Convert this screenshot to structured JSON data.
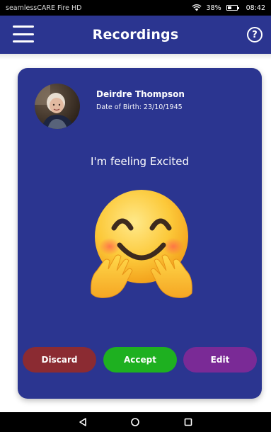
{
  "status_bar": {
    "app_name": "seamlessCARE Fire HD",
    "battery_percent": "38%",
    "battery_level": 0.38,
    "time": "08:42"
  },
  "header": {
    "title": "Recordings",
    "help_label": "?"
  },
  "patient": {
    "name": "Deirdre Thompson",
    "dob": "Date of Birth: 23/10/1945"
  },
  "recording": {
    "feeling": "I'm feeling Excited",
    "emoji_icon": "hugging-face-emoji"
  },
  "actions": {
    "discard": "Discard",
    "accept": "Accept",
    "edit": "Edit"
  },
  "colors": {
    "brand": "#2b3590",
    "discard": "#8b2b32",
    "accept": "#1eb020",
    "edit": "#7a2a96"
  },
  "navigation": {
    "back_icon": "back-triangle-icon",
    "home_icon": "home-circle-icon",
    "recents_icon": "recents-square-icon"
  }
}
